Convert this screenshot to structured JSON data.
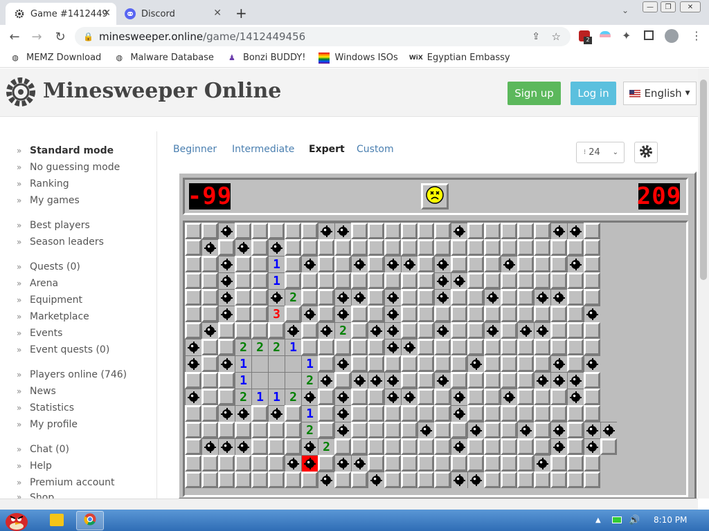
{
  "browser": {
    "tabs": [
      {
        "title": "Game #1412449",
        "active": true,
        "icon": "gear-logo-icon"
      },
      {
        "title": "Discord",
        "active": false,
        "icon": "discord-icon"
      }
    ],
    "url_host": "minesweeper.online",
    "url_path": "/game/1412449456",
    "bookmarks": [
      {
        "label": "MEMZ Download",
        "icon": "globe-icon"
      },
      {
        "label": "Malware Database",
        "icon": "globe-icon"
      },
      {
        "label": "Bonzi BUDDY!",
        "icon": "bonzi-icon"
      },
      {
        "label": "Windows ISOs",
        "icon": "rainbow-flag-icon"
      },
      {
        "label": "Egyptian Embassy",
        "icon": "wix-icon"
      }
    ],
    "extension_badge": "2"
  },
  "site": {
    "title": "Minesweeper Online",
    "signup": "Sign up",
    "login": "Log in",
    "language": "English",
    "colors": {
      "signup": "#5cb85c",
      "login": "#5bc0de"
    }
  },
  "sidebar": {
    "items": [
      "Standard mode",
      "No guessing mode",
      "Ranking",
      "My games",
      "Best players",
      "Season leaders",
      "Quests (0)",
      "Arena",
      "Equipment",
      "Marketplace",
      "Events",
      "Event quests (0)",
      "Players online (746)",
      "News",
      "Statistics",
      "My profile",
      "Chat (0)",
      "Help",
      "Premium account",
      "Shop"
    ]
  },
  "modes": {
    "beginner": "Beginner",
    "intermediate": "Intermediate",
    "expert": "Expert",
    "custom": "Custom",
    "selected": "Expert"
  },
  "zoom": "24",
  "game": {
    "mines_left": "-99",
    "timer": "209",
    "state": "lost",
    "board_rows": [
      "..m.....mm......m.....mm.",
      ".m.m.m...................",
      "..m..1.m..m.mm.m...m...m.",
      "..m..1.........mm........",
      "..m..m2..mm.m..m..m..mm..",
      "..m..3.m.m..m...........m",
      ".m....m.m2.mm..m..m.mm...",
      "m..2221.....mm...........",
      "m.m1ooo1.m.......m....m.m",
      "...1ooo2m.mmm..m.....mmm.",
      "m..2112m.m..mm..m..m...m.",
      "..mm.m.1.m......m........",
      ".......2.m....m..m..m.m.mm",
      ".mmm...m2.......m.....m.m.",
      "......mX.mm..........m...",
      "........m..m....mm......."
    ]
  },
  "taskbar": {
    "time": "8:10 PM"
  }
}
